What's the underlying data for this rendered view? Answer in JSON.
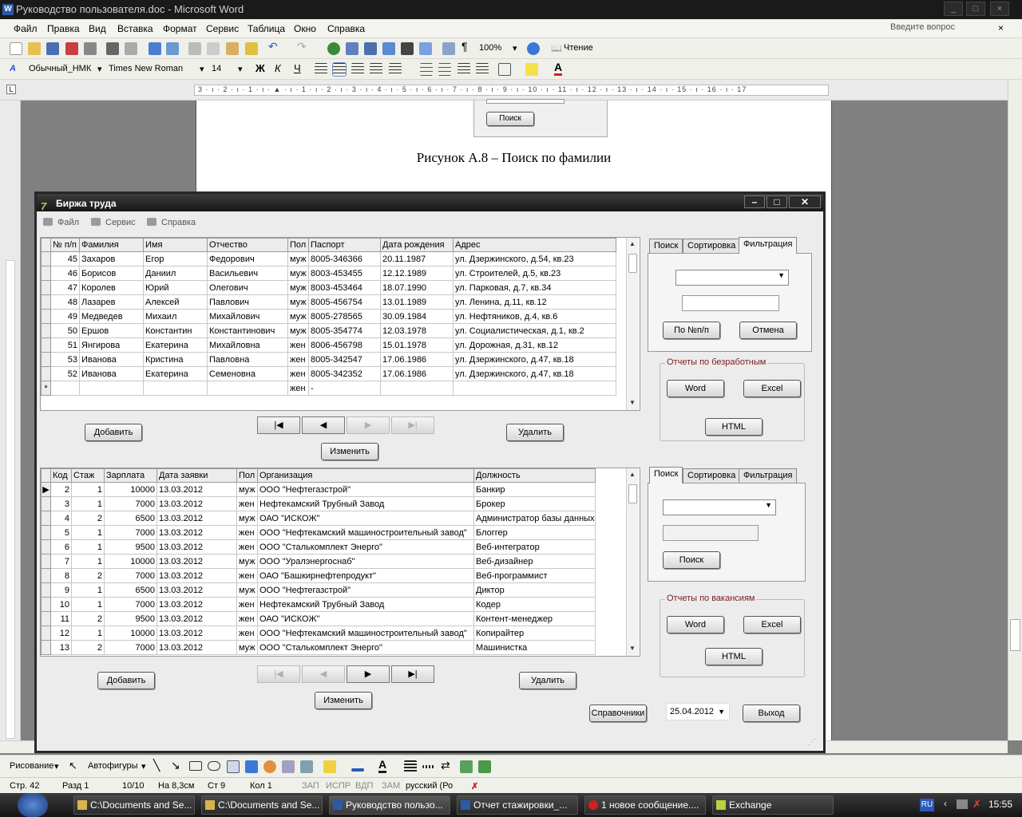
{
  "word": {
    "title": "Руководство пользователя.doc - Microsoft Word",
    "min": "_",
    "max": "□",
    "close": "×",
    "menu": [
      "Файл",
      "Правка",
      "Вид",
      "Вставка",
      "Формат",
      "Сервис",
      "Таблица",
      "Окно",
      "Справка"
    ],
    "ask": "Введите вопрос",
    "zoom": "100%",
    "read": "Чтение",
    "style": "Обычный_НМК",
    "font": "Times New Roman",
    "size": "14",
    "bold": "Ж",
    "italic": "К",
    "underline": "Ч",
    "ruler": "3 · ı · 2 · ı · 1 · ı · ▲ · ı · 1 · ı · 2 · ı · 3 · ı · 4 · ı · 5 · ı · 6 · ı · 7 · ı · 8 · ı · 9 · ı · 10 · ı · 11 · ı · 12 · ı · 13 · ı · 14 · ı · 15 · ı · 16 · ı · 17",
    "doc_button": "Поиск",
    "caption": "Рисунок А.8 – Поиск по фамилии",
    "draw": "Рисование",
    "autoshapes": "Автофигуры",
    "status": {
      "page": "Стр. 42",
      "section": "Разд 1",
      "pages": "10/10",
      "at": "На 8,3см",
      "line": "Ст 9",
      "col": "Кол 1",
      "rec": "ЗАП",
      "trk": "ИСПР",
      "ext": "ВДП",
      "ovr": "ЗАМ",
      "lang": "русский (Ро"
    }
  },
  "taskbar": {
    "items": [
      "C:\\Documents and Se...",
      "C:\\Documents and Se...",
      "Руководство пользо...",
      "Отчет стажировки_...",
      "1 новое сообщение....",
      "Exchange"
    ],
    "lang": "RU",
    "time": "15:55"
  },
  "app": {
    "title": "Биржа труда",
    "menu": [
      "Файл",
      "Сервис",
      "Справка"
    ],
    "grid1": {
      "headers": [
        "№ п/п",
        "Фамилия",
        "Имя",
        "Отчество",
        "Пол",
        "Паспорт",
        "Дата рождения",
        "Адрес"
      ],
      "rows": [
        [
          "45",
          "Захаров",
          "Егор",
          "Федорович",
          "муж",
          "8005-346366",
          "20.11.1987",
          "ул. Дзержинского, д.54, кв.23"
        ],
        [
          "46",
          "Борисов",
          "Даниил",
          "Васильевич",
          "муж",
          "8003-453455",
          "12.12.1989",
          "ул. Строителей, д.5, кв.23"
        ],
        [
          "47",
          "Королев",
          "Юрий",
          "Олегович",
          "муж",
          "8003-453464",
          "18.07.1990",
          "ул. Парковая, д.7, кв.34"
        ],
        [
          "48",
          "Лазарев",
          "Алексей",
          "Павлович",
          "муж",
          "8005-456754",
          "13.01.1989",
          "ул. Ленина, д.11, кв.12"
        ],
        [
          "49",
          "Медведев",
          "Михаил",
          "Михайлович",
          "муж",
          "8005-278565",
          "30.09.1984",
          "ул. Нефтяников, д.4, кв.6"
        ],
        [
          "50",
          "Ершов",
          "Константин",
          "Константинович",
          "муж",
          "8005-354774",
          "12.03.1978",
          "ул. Социалистическая, д.1, кв.2"
        ],
        [
          "51",
          "Янгирова",
          "Екатерина",
          "Михайловна",
          "жен",
          "8006-456798",
          "15.01.1978",
          "ул. Дорожная, д.31, кв.12"
        ],
        [
          "53",
          "Иванова",
          "Кристина",
          "Павловна",
          "жен",
          "8005-342547",
          "17.06.1986",
          "ул. Дзержинского, д.47, кв.18"
        ],
        [
          "52",
          "Иванова",
          "Екатерина",
          "Семеновна",
          "жен",
          "8005-342352",
          "17.06.1986",
          "ул. Дзержинского, д.47, кв.18"
        ],
        [
          "",
          "",
          "",
          "",
          "жен",
          "-",
          "",
          ""
        ]
      ]
    },
    "grid2": {
      "headers": [
        "Код",
        "Стаж",
        "Зарплата",
        "Дата заявки",
        "Пол",
        "Организация",
        "Должность"
      ],
      "rows": [
        [
          "2",
          "1",
          "10000",
          "13.03.2012",
          "муж",
          "ООО \"Нефтегазстрой\"",
          "Банкир"
        ],
        [
          "3",
          "1",
          "7000",
          "13.03.2012",
          "жен",
          "Нефтекамский Трубный Завод",
          "Брокер"
        ],
        [
          "4",
          "2",
          "6500",
          "13.03.2012",
          "муж",
          "ОАО \"ИСКОЖ\"",
          "Администратор базы данных"
        ],
        [
          "5",
          "1",
          "7000",
          "13.03.2012",
          "жен",
          "ООО \"Нефтекамский машиностроительный завод\"",
          "Блоггер"
        ],
        [
          "6",
          "1",
          "9500",
          "13.03.2012",
          "жен",
          "ООО \"Сталькомплект Энерго\"",
          "Веб-интегратор"
        ],
        [
          "7",
          "1",
          "10000",
          "13.03.2012",
          "муж",
          "ООО \"Уралэнергоснаб\"",
          "Веб-дизайнер"
        ],
        [
          "8",
          "2",
          "7000",
          "13.03.2012",
          "жен",
          "ОАО \"Башкирнефтепродукт\"",
          "Веб-программист"
        ],
        [
          "9",
          "1",
          "6500",
          "13.03.2012",
          "муж",
          "ООО \"Нефтегазстрой\"",
          "Диктор"
        ],
        [
          "10",
          "1",
          "7000",
          "13.03.2012",
          "жен",
          "Нефтекамский Трубный Завод",
          "Кодер"
        ],
        [
          "11",
          "2",
          "9500",
          "13.03.2012",
          "жен",
          "ОАО \"ИСКОЖ\"",
          "Контент-менеджер"
        ],
        [
          "12",
          "1",
          "10000",
          "13.03.2012",
          "жен",
          "ООО \"Нефтекамский машиностроительный завод\"",
          "Копирайтер"
        ],
        [
          "13",
          "2",
          "7000",
          "13.03.2012",
          "муж",
          "ООО \"Сталькомплект Энерго\"",
          "Машинистка"
        ]
      ]
    },
    "buttons": {
      "add": "Добавить",
      "delete": "Удалить",
      "edit": "Изменить",
      "by_num": "По №п/п",
      "cancel": "Отмена",
      "word": "Word",
      "excel": "Excel",
      "html": "HTML",
      "search": "Поиск",
      "refs": "Справочники",
      "exit": "Выход"
    },
    "tabs": [
      "Поиск",
      "Сортировка",
      "Фильтрация"
    ],
    "reports1": "Отчеты по безработным",
    "reports2": "Отчеты по вакансиям",
    "date": "25.04.2012"
  }
}
